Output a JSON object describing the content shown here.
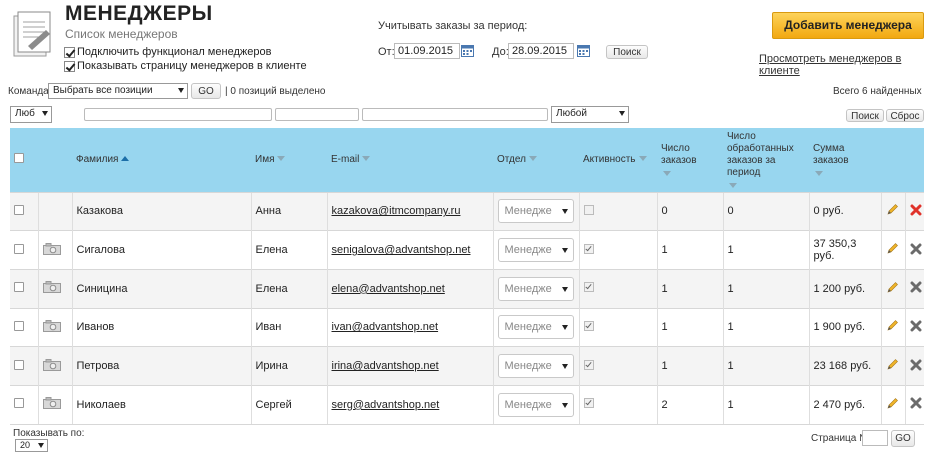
{
  "header": {
    "title": "МЕНЕДЖЕРЫ",
    "subtitle": "Список менеджеров",
    "checkbox_enable": "Подключить функционал менеджеров",
    "checkbox_show_page": "Показывать страницу менеджеров в клиенте"
  },
  "period": {
    "label": "Учитывать заказы за период:",
    "from_label": "От:",
    "from_value": "01.09.2015",
    "to_label": "До:",
    "to_value": "28.09.2015",
    "search_label": "Поиск"
  },
  "actions": {
    "add_manager": "Добавить менеджера",
    "view_link": "Просмотреть менеджеров в клиенте"
  },
  "command": {
    "label": "Команда:",
    "selected_option": "Выбрать все позиции",
    "go_label": "GO",
    "selected_count": "| 0 позиций выделено",
    "found": "Всего 6 найденных"
  },
  "filters": {
    "first_select": "Люб",
    "activity_select": "Любой",
    "search_label": "Поиск",
    "reset_label": "Сброс"
  },
  "table": {
    "columns": {
      "surname": "Фамилия",
      "name": "Имя",
      "email": "E-mail",
      "department": "Отдел",
      "active": "Активность",
      "orders": "Число заказов",
      "processed": "Число обработанных заказов за период",
      "sum": "Сумма заказов"
    },
    "rows": [
      {
        "surname": "Казакова",
        "name": "Анна",
        "email": "kazakova@itmcompany.ru",
        "department": "Менедже",
        "active": false,
        "orders": "0",
        "processed": "0",
        "sum": "0 руб.",
        "photo": false,
        "delete_color": "#e0322a"
      },
      {
        "surname": "Сигалова",
        "name": "Елена",
        "email": "senigalova@advantshop.net",
        "department": "Менедже",
        "active": true,
        "orders": "1",
        "processed": "1",
        "sum": "37 350,3 руб.",
        "photo": true,
        "delete_color": "#6b6b6b"
      },
      {
        "surname": "Синицина",
        "name": "Елена",
        "email": "elena@advantshop.net",
        "department": "Менедже",
        "active": true,
        "orders": "1",
        "processed": "1",
        "sum": "1 200 руб.",
        "photo": true,
        "delete_color": "#6b6b6b"
      },
      {
        "surname": "Иванов",
        "name": "Иван",
        "email": "ivan@advantshop.net",
        "department": "Менедже",
        "active": true,
        "orders": "1",
        "processed": "1",
        "sum": "1 900 руб.",
        "photo": true,
        "delete_color": "#6b6b6b"
      },
      {
        "surname": "Петрова",
        "name": "Ирина",
        "email": "irina@advantshop.net",
        "department": "Менедже",
        "active": true,
        "orders": "1",
        "processed": "1",
        "sum": "23 168 руб.",
        "photo": true,
        "delete_color": "#6b6b6b"
      },
      {
        "surname": "Николаев",
        "name": "Сергей",
        "email": "serg@advantshop.net",
        "department": "Менедже",
        "active": true,
        "orders": "2",
        "processed": "1",
        "sum": "2 470 руб.",
        "photo": true,
        "delete_color": "#6b6b6b"
      }
    ]
  },
  "footer": {
    "show_by_label": "Показывать по:",
    "show_by_value": "20",
    "page_label": "Страница №",
    "go_label": "GO"
  },
  "colors": {
    "accent_button": "#f7bd2c",
    "table_header": "#98d6ef",
    "active_number": "#2a7d2a"
  }
}
